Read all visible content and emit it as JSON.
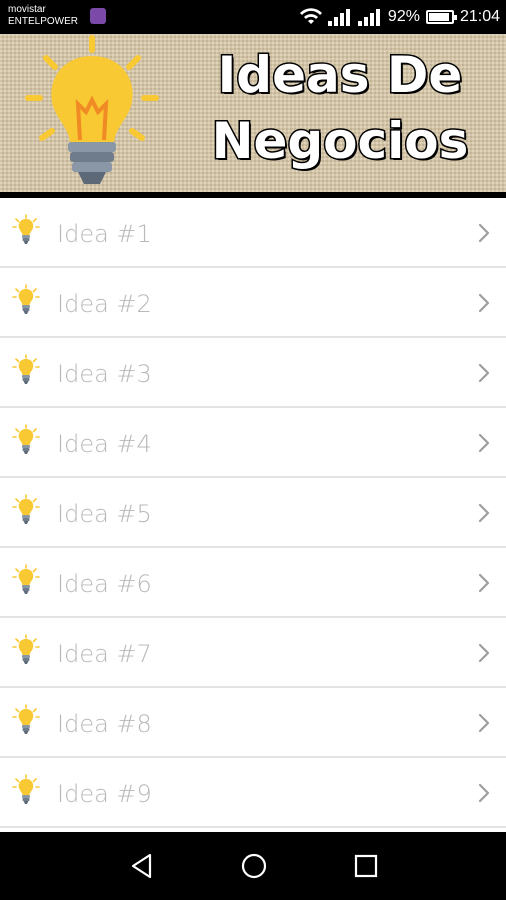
{
  "status_bar": {
    "carrier_line1": "movistar",
    "carrier_line2": "ENTELPOWER",
    "battery": "92%",
    "battery_level": 0.92,
    "time": "21:04"
  },
  "header": {
    "title_line1": "Ideas De",
    "title_line2": "Negocios"
  },
  "list": {
    "items": [
      {
        "label": "Idea #1"
      },
      {
        "label": "Idea #2"
      },
      {
        "label": "Idea #3"
      },
      {
        "label": "Idea #4"
      },
      {
        "label": "Idea #5"
      },
      {
        "label": "Idea #6"
      },
      {
        "label": "Idea #7"
      },
      {
        "label": "Idea #8"
      },
      {
        "label": "Idea #9"
      }
    ]
  },
  "icons": {
    "row": "lightbulb-icon",
    "chevron": "chevron-right-icon",
    "nav": [
      "back-icon",
      "home-icon",
      "recents-icon"
    ]
  },
  "colors": {
    "bulb_yellow": "#f9c933",
    "bulb_base": "#7f8c9a",
    "label_gray": "#b9b9b9"
  }
}
